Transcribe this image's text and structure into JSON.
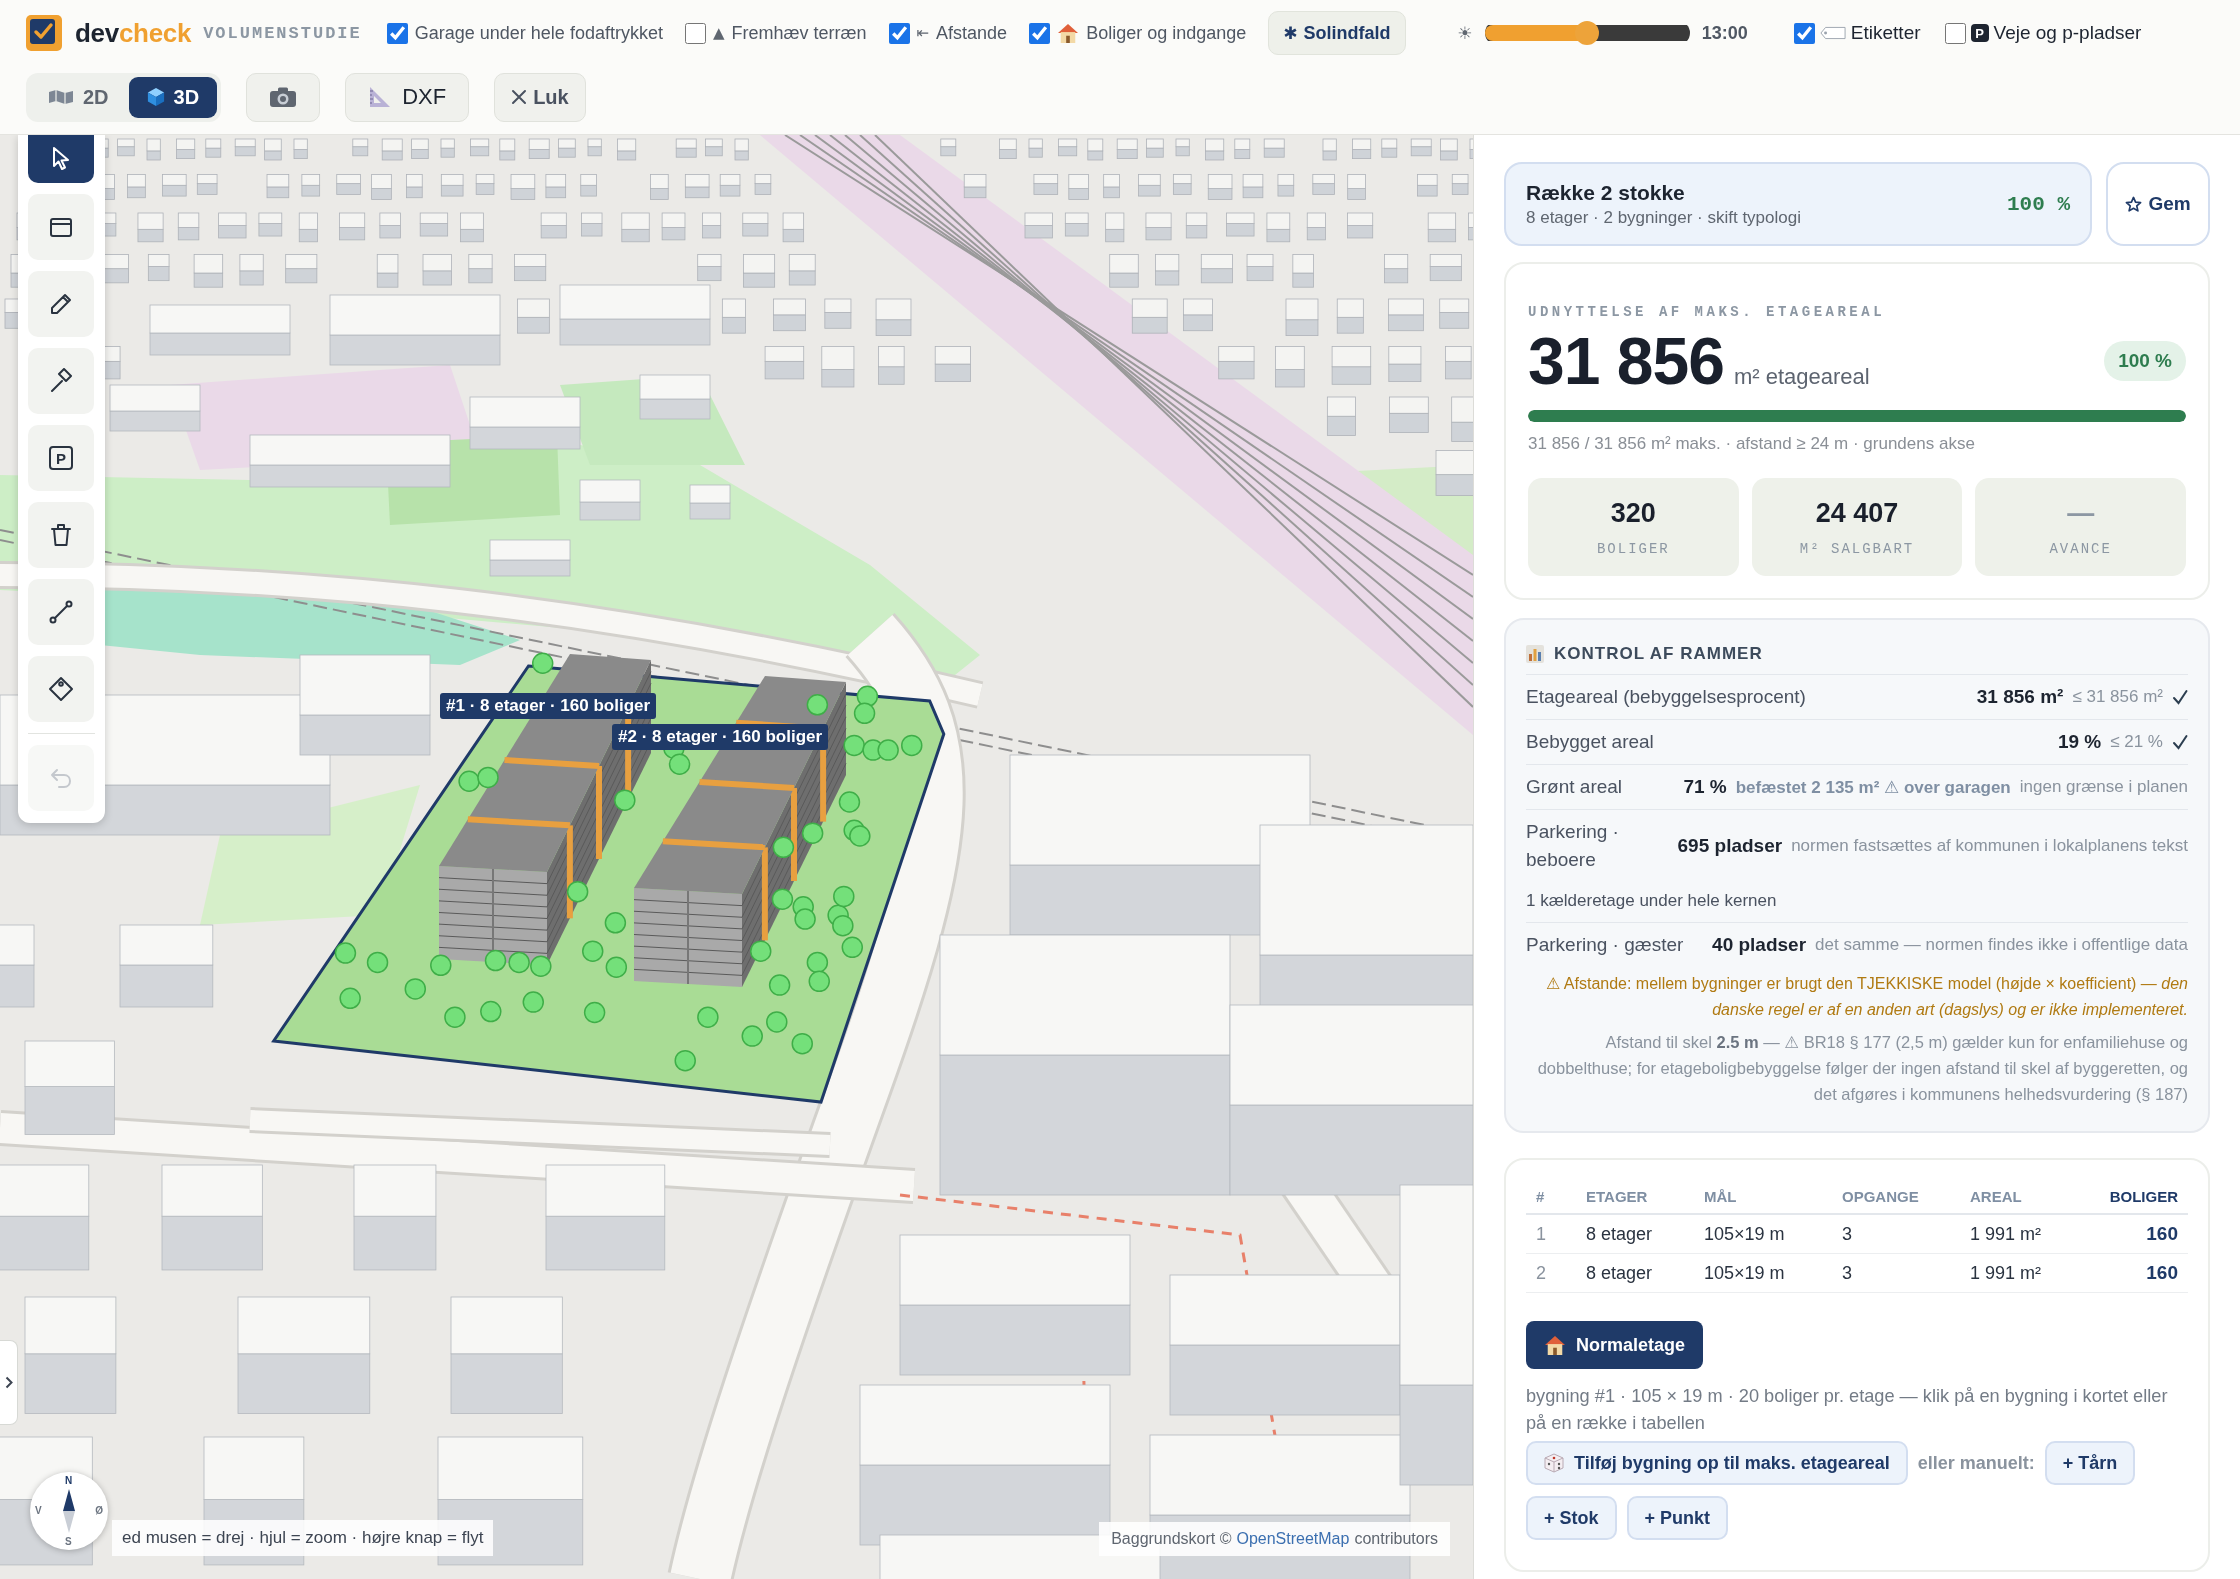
{
  "header": {
    "logo": {
      "first": "dev",
      "second": "check"
    },
    "subtitle": "VOLUMENSTUDIE",
    "toggles": [
      {
        "label": "Garage under hele fodaftrykket",
        "checked": true,
        "kind": "plain"
      },
      {
        "label": "Fremhæv terræn",
        "checked": false,
        "kind": "terrain",
        "glyph": "▲"
      },
      {
        "label": "Afstande",
        "checked": true,
        "kind": "distance",
        "glyph": "⇤"
      },
      {
        "label": "Boliger og indgange",
        "checked": true,
        "kind": "house"
      }
    ],
    "sun_button": {
      "glyph": "✱",
      "label": "Solindfald"
    },
    "sun_glyph": "☀",
    "time_slider": {
      "level": 0.5,
      "reading": "13:00"
    },
    "layer_toggles": [
      {
        "label": "Etiketter",
        "checked": true,
        "kind": "tag"
      },
      {
        "label": "Veje og p-pladser",
        "checked": false,
        "kind": "parking",
        "glyph": "P"
      }
    ],
    "view_modes": [
      {
        "label": "2D",
        "selected": false,
        "kind": "map"
      },
      {
        "label": "3D",
        "selected": true,
        "kind": "cube"
      }
    ],
    "actions": [
      {
        "kind": "camera"
      },
      {
        "kind": "ruler",
        "label": "DXF"
      },
      {
        "kind": "close",
        "label": "Luk"
      }
    ]
  },
  "map": {
    "tools": [
      {
        "kind": "pointer",
        "selected": true,
        "disabled": false
      },
      {
        "kind": "rectangle",
        "selected": false,
        "disabled": false
      },
      {
        "kind": "pencil",
        "selected": false,
        "disabled": false
      },
      {
        "kind": "hammer",
        "selected": false,
        "disabled": false
      },
      {
        "kind": "parking",
        "glyph": "P",
        "selected": false,
        "disabled": false
      },
      {
        "kind": "trash",
        "selected": false,
        "disabled": false
      },
      {
        "kind": "route",
        "selected": false,
        "disabled": false
      },
      {
        "kind": "tag",
        "selected": false,
        "disabled": false
      },
      {
        "kind": "undo",
        "selected": false,
        "disabled": true
      }
    ],
    "building_labels": [
      "#1 · 8 etager · 160 boliger",
      "#2 · 8 etager · 160 boliger"
    ],
    "compass": {
      "north": "N",
      "west": "V",
      "east": "Ø",
      "south": "S"
    },
    "hint": "ed musen = drej · hjul = zoom · højre knap = flyt",
    "attribution": {
      "prefix": "Baggrundskort ©",
      "link": "OpenStreetMap",
      "suffix": "contributors"
    }
  },
  "panel": {
    "profile": {
      "title": "Række 2 stokke",
      "subtitle": "8 etager · 2 bygninger · skift typologi",
      "percent": "100 %"
    },
    "save_label": "Gem",
    "utilization": {
      "label": "UDNYTTELSE AF MAKS. ETAGEAREAL",
      "value": "31 856",
      "unit": "m² etageareal",
      "badge": "100 %",
      "level": 1.0,
      "caption": "31 856 / 31 856 m² maks. · afstand ≥ 24 m · grundens akse"
    },
    "stats": [
      {
        "value": "320",
        "label": "BOLIGER",
        "muted": false
      },
      {
        "value": "24 407",
        "label": "M² SALGBART",
        "muted": false
      },
      {
        "value": "—",
        "label": "AVANCE",
        "muted": true
      }
    ],
    "checks": {
      "title": "KONTROL AF RAMMER",
      "rows": [
        {
          "kind": "metric",
          "label": "Etageareal (bebyggelsesprocent)",
          "value": "31 856 m²",
          "limit": "≤ 31 856 m²",
          "passed": true
        },
        {
          "kind": "metric",
          "label": "Bebygget areal",
          "value": "19 %",
          "limit": "≤ 21 %",
          "passed": true
        },
        {
          "kind": "metric",
          "label": "Grønt areal",
          "value": "71 %",
          "detail": "befæstet 2 135 m² ⚠ over garagen",
          "limit": "ingen grænse i planen",
          "passed": false
        },
        {
          "kind": "metric",
          "label": "Parkering · beboere",
          "value": "695 pladser",
          "limit": "normen fastsættes af kommunen i lokalplanens tekst",
          "passed": false
        },
        {
          "kind": "note",
          "text": "1 kælderetage under hele kernen"
        },
        {
          "kind": "metric",
          "label": "Parkering · gæster",
          "value": "40 pladser",
          "limit": "det samme — normen findes ikke i offentlige data",
          "passed": false
        }
      ],
      "warning": "⚠ Afstande: mellem bygninger er brugt den TJEKKISKE model (højde × koefficient) — *den danske regel er af en anden art (dagslys) og er ikke implementeret.*",
      "setback": "Afstand til skel **2.5 m** — ⚠ BR18 § 177 (2,5 m) gælder kun for enfamiliehuse og dobbelthuse; for etageboligbebyggelse følger der ingen afstand til skel af byggeretten, og det afgøres i kommunens helhedsvurdering (§ 187)"
    },
    "table": {
      "columns": [
        {
          "label": "#",
          "emphasized": false
        },
        {
          "label": "ETAGER",
          "emphasized": false
        },
        {
          "label": "MÅL",
          "emphasized": false
        },
        {
          "label": "OPGANGE",
          "emphasized": false
        },
        {
          "label": "AREAL",
          "emphasized": false
        },
        {
          "label": "BOLIGER",
          "emphasized": true
        }
      ],
      "rows": [
        [
          "1",
          "8 etager",
          "105×19 m",
          "3",
          "1 991 m²",
          "160"
        ],
        [
          "2",
          "8 etager",
          "105×19 m",
          "3",
          "1 991 m²",
          "160"
        ]
      ]
    },
    "floor_button": "Normaletage",
    "selection_hint": "bygning #1 · 105 × 19 m · 20 boliger pr. etage — klik på en bygning i kortet eller på en række i tabellen",
    "auto_button": "Tilføj bygning op til maks. etageareal",
    "manual_label": "eller manuelt:",
    "add_buttons": [
      "+ Tårn",
      "+ Stok",
      "+ Punkt"
    ]
  }
}
